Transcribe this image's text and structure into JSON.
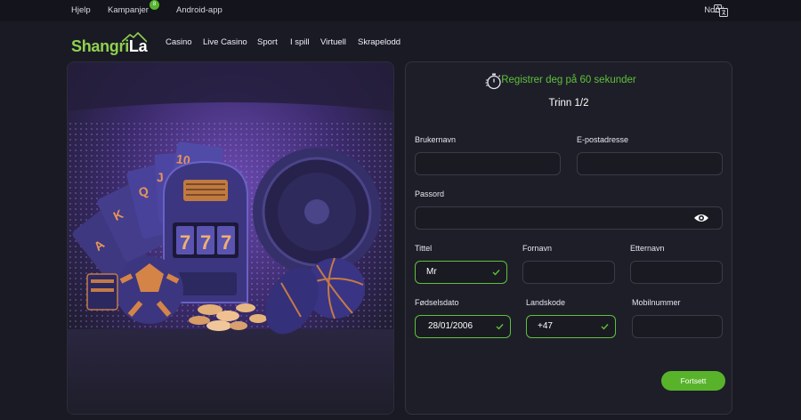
{
  "topbar": {
    "help": "Hjelp",
    "campaigns": "Kampanjer",
    "campaigns_badge": "8",
    "android": "Android-app",
    "language": "Norsk"
  },
  "logo": {
    "part1": "Shangri",
    "part2": "La"
  },
  "nav": {
    "items": [
      "Casino",
      "Live Casino",
      "Sport",
      "I spill",
      "Virtuell",
      "Skrapelodd"
    ]
  },
  "hero": {
    "card_ranks": [
      "A",
      "K",
      "Q",
      "J",
      "10"
    ],
    "slot_digits": [
      "7",
      "7",
      "7"
    ]
  },
  "form": {
    "headline": "Registrer deg på 60 sekunder",
    "step": "Trinn 1/2",
    "username_label": "Brukernavn",
    "username_value": "",
    "email_label": "E-postadresse",
    "email_value": "",
    "password_label": "Passord",
    "password_value": "",
    "title_label": "Tittel",
    "title_value": "Mr",
    "firstname_label": "Fornavn",
    "firstname_value": "",
    "lastname_label": "Etternavn",
    "lastname_value": "",
    "dob_label": "Fødselsdato",
    "dob_value": "28/01/2006",
    "country_code_label": "Landskode",
    "country_code_value": "+47",
    "mobile_label": "Mobilnummer",
    "mobile_value": "",
    "continue_button": "Fortsett"
  },
  "colors": {
    "accent_green": "#58b32b",
    "headline_green": "#5ec03a",
    "background": "#1a1a24",
    "panel": "#1e1e28"
  },
  "icons": {
    "timer": "stopwatch-icon",
    "eye": "eye-icon",
    "check": "check-icon",
    "language": "translate-icon"
  }
}
